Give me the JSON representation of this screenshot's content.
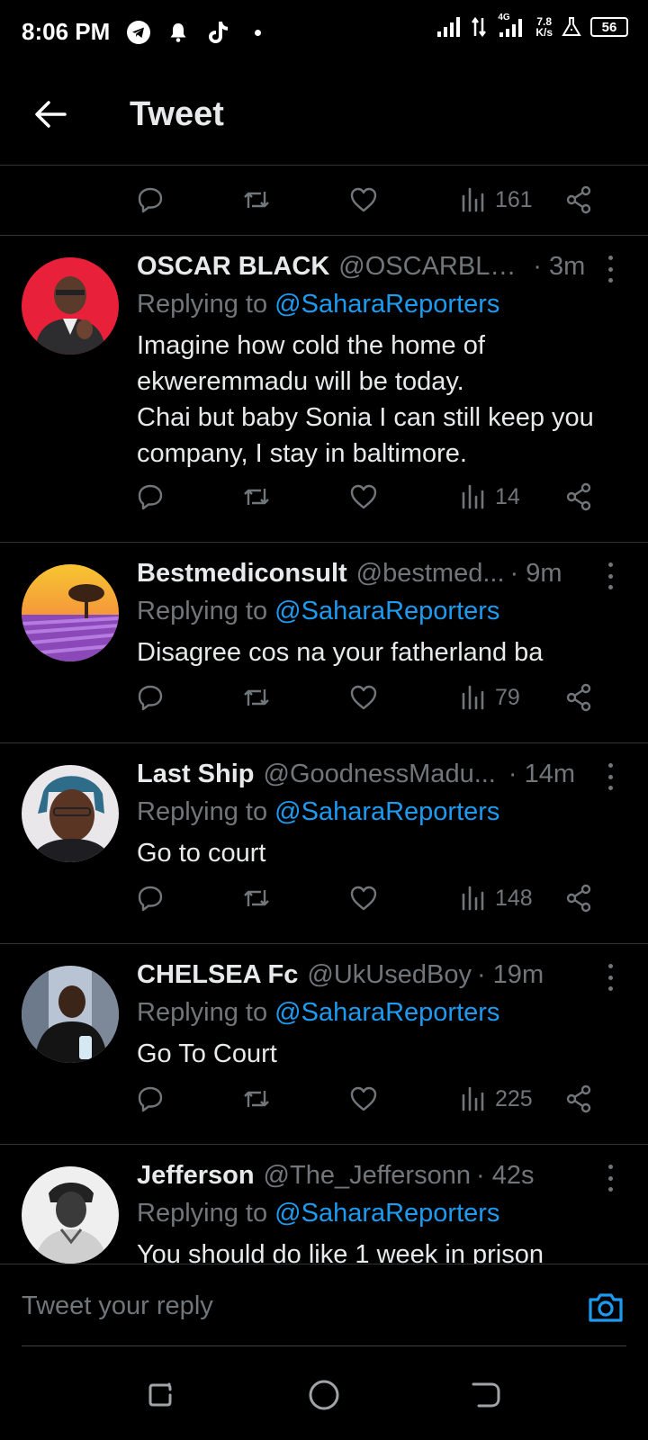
{
  "status_bar": {
    "time": "8:06 PM",
    "network": "4G",
    "speed_value": "7.8",
    "speed_unit": "K/s",
    "battery": "56",
    "icons_left": [
      "telegram-icon",
      "notification-bell-icon",
      "tiktok-icon",
      "dot-icon"
    ],
    "icons_right": [
      "signal-icon",
      "data-arrows-icon",
      "signal-4g-icon",
      "speed-readout",
      "lab-icon",
      "battery-icon"
    ]
  },
  "header": {
    "title": "Tweet",
    "back_icon": "arrow-left-icon"
  },
  "top_actions": {
    "views": "161"
  },
  "tweets": [
    {
      "name": "OSCAR BLACK",
      "handle": "@OSCARBLA...",
      "time": "· 3m",
      "replying_prefix": "Replying to",
      "replying_to": "@SaharaReporters",
      "text": "Imagine  how cold the home of ekweremmadu  will be today.\nChai but baby Sonia I can still keep you company, I stay in baltimore.",
      "views": "14"
    },
    {
      "name": "Bestmediconsult",
      "handle": "@bestmed...",
      "time": "· 9m",
      "replying_prefix": "Replying to",
      "replying_to": "@SaharaReporters",
      "text": "Disagree cos na your fatherland ba",
      "views": "79"
    },
    {
      "name": "Last Ship",
      "handle": "@GoodnessMadu...",
      "time": "· 14m",
      "replying_prefix": "Replying to",
      "replying_to": "@SaharaReporters",
      "text": "Go to court",
      "views": "148"
    },
    {
      "name": "CHELSEA Fc",
      "handle": "@UkUsedBoy",
      "time": "· 19m",
      "replying_prefix": "Replying to",
      "replying_to": "@SaharaReporters",
      "text": "Go To Court",
      "views": "225"
    },
    {
      "name": "Jefferson",
      "handle": "@The_Jeffersonn",
      "time": "· 42s",
      "replying_prefix": "Replying to",
      "replying_to": "@SaharaReporters",
      "text": "You should do like 1 week in prison",
      "views": ""
    }
  ],
  "composer": {
    "placeholder": "Tweet your reply",
    "camera_icon": "camera-icon"
  },
  "colors": {
    "background": "#000000",
    "text": "#e7e9ea",
    "muted": "#71767b",
    "link": "#1d9bf0",
    "divider": "#2f3336"
  }
}
